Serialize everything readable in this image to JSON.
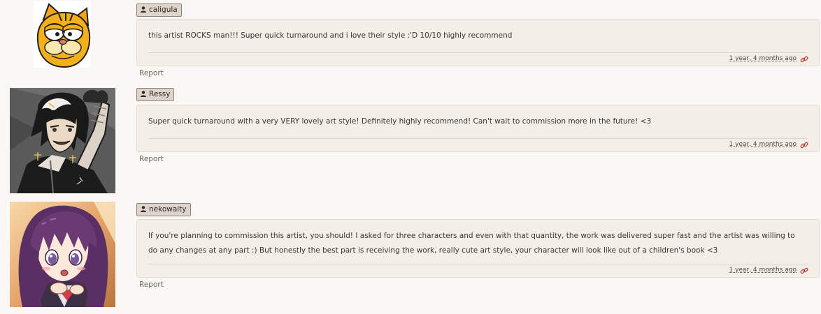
{
  "comments": [
    {
      "username": "caligula",
      "avatar": "garfield-avatar",
      "text": "this artist ROCKS man!!! Super quick turnaround and i love their style :'D 10/10 highly recommend",
      "timestamp": "1 year, 4 months ago",
      "report_label": "Report"
    },
    {
      "username": "Ressy",
      "avatar": "ressy-avatar",
      "text": "Super quick turnaround with a very VERY lovely art style! Definitely highly recommend! Can't wait to commission more in the future! <3",
      "timestamp": "1 year, 4 months ago",
      "report_label": "Report"
    },
    {
      "username": "nekowaity",
      "avatar": "nekowaity-avatar",
      "text": "If you're planning to commission this artist, you should! I asked for three characters and even with that quantity, the work was delivered super fast and the artist was willing to do any changes at any part :) But honestly the best part is receiving the work, really cute art style, your character will look like out of a children's book <3",
      "timestamp": "1 year, 4 months ago",
      "report_label": "Report"
    }
  ],
  "colors": {
    "page_background": "#faf8f4",
    "panel_background": "#f4eee8",
    "badge_background": "#ddd5cb",
    "link_icon": "#c0392b"
  },
  "icons": {
    "user": "user-icon",
    "permalink": "link-icon"
  }
}
